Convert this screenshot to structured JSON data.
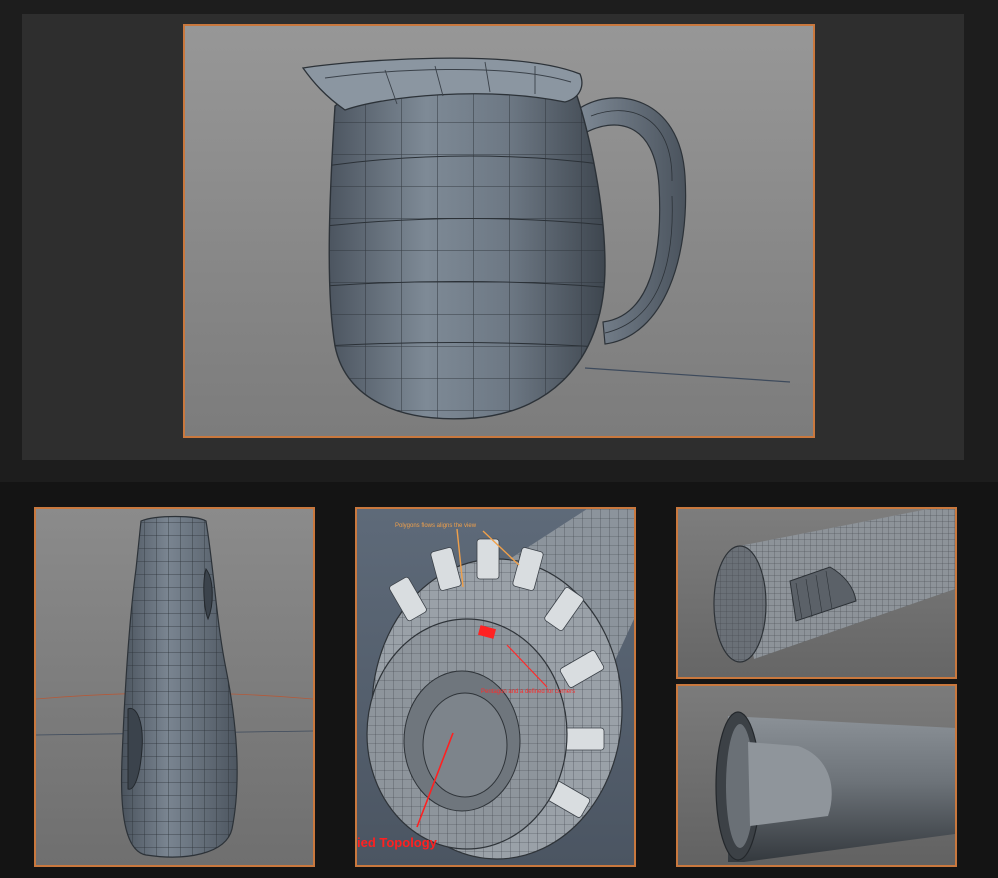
{
  "annotations": {
    "polygon_note": "Polygons flows aligns the view",
    "pentagon_note": "Pentagon and a defined for corners",
    "topology_label": "ied Topology"
  },
  "colors": {
    "viewport_border": "#c9783e",
    "annotation_orange": "#f0a04a",
    "annotation_red": "#ff2a2a",
    "mesh_fill": "#6e7a86",
    "wire": "#2c3238"
  },
  "viewports": [
    {
      "name": "pitcher-viewport",
      "subject": "pitcher-mesh"
    },
    {
      "name": "handle-viewport",
      "subject": "handle-mesh"
    },
    {
      "name": "cylinder-topology-viewport",
      "subject": "vented-cylinder-mesh"
    },
    {
      "name": "tube-wireframe-viewport",
      "subject": "tube-cut-wireframe"
    },
    {
      "name": "tube-smooth-viewport",
      "subject": "tube-cut-smooth"
    }
  ]
}
